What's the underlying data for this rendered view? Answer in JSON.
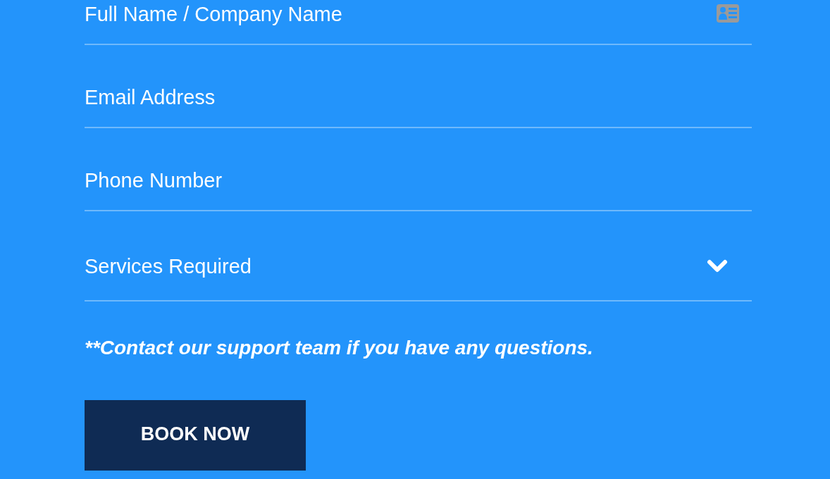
{
  "form": {
    "fields": [
      {
        "kind": "input",
        "placeholder": "Full Name / Company Name"
      },
      {
        "kind": "input",
        "placeholder": "Email Address"
      },
      {
        "kind": "input",
        "placeholder": "Phone Number"
      },
      {
        "kind": "select",
        "placeholder": "Services Required"
      }
    ],
    "note": "**Contact our support team if you have any questions.",
    "submit": "BOOK NOW"
  }
}
